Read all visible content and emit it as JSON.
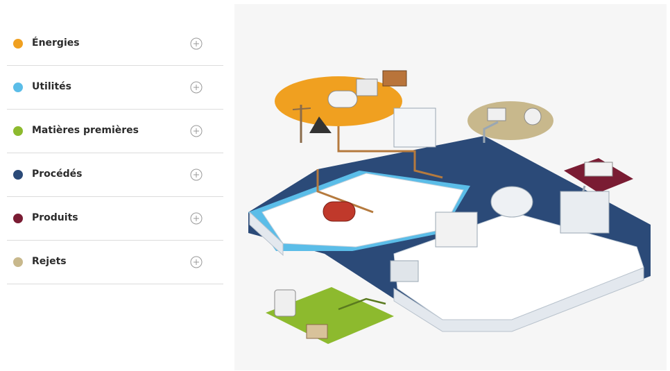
{
  "categories": [
    {
      "label": "Énergies",
      "color": "#f0a020",
      "icon": "plus-circle-icon"
    },
    {
      "label": "Utilités",
      "color": "#5bbde8",
      "icon": "plus-circle-icon"
    },
    {
      "label": "Matières premières",
      "color": "#8dba2e",
      "icon": "plus-circle-icon"
    },
    {
      "label": "Procédés",
      "color": "#2b4a78",
      "icon": "plus-circle-icon"
    },
    {
      "label": "Produits",
      "color": "#7a1c33",
      "icon": "plus-circle-icon"
    },
    {
      "label": "Rejets",
      "color": "#c8b88c",
      "icon": "plus-circle-icon"
    }
  ],
  "colors": {
    "energy_flow": "#b57a3e",
    "utilities_zone": "#5bbde8",
    "process_zone": "#2b4a78",
    "raw_materials_zone": "#8dba2e",
    "products_zone": "#7a1c33",
    "waste_zone": "#c8b88c"
  }
}
